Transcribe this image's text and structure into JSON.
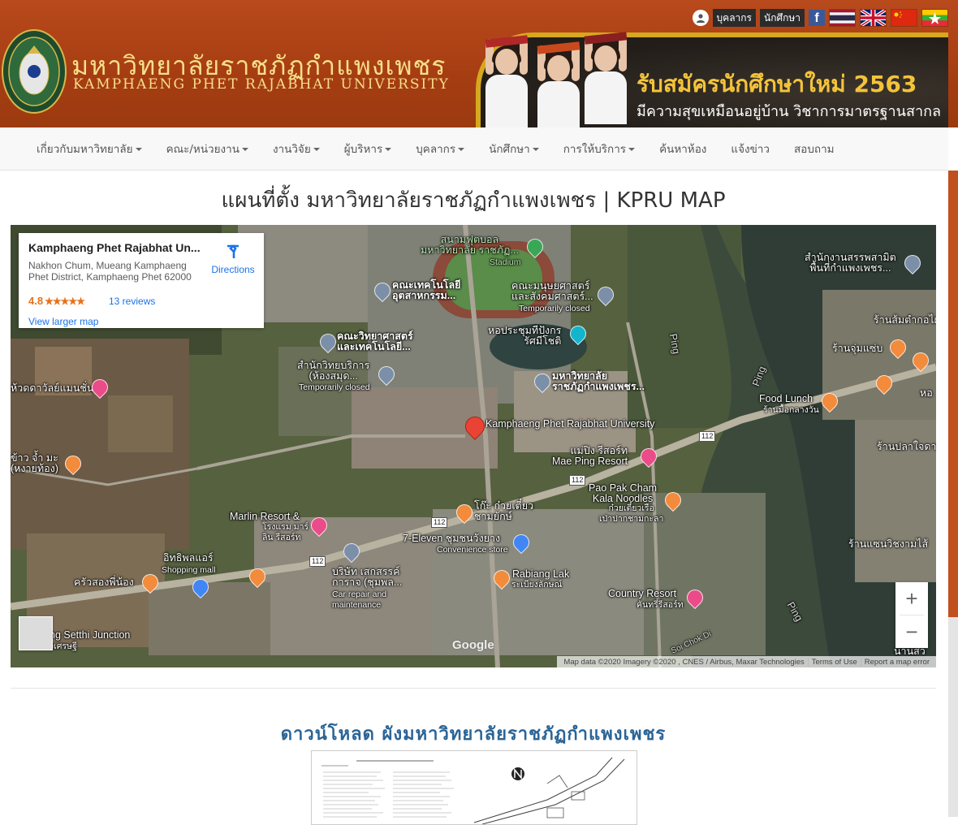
{
  "topbar": {
    "staff_label": "บุคลากร",
    "student_label": "นักศึกษา",
    "facebook_letter": "f"
  },
  "university": {
    "name_th": "มหาวิทยาลัยราชภัฏกำแพงเพชร",
    "name_en": "KAMPHAENG PHET RAJABHAT UNIVERSITY"
  },
  "banner": {
    "headline": "รับสมัครนักศึกษาใหม่ 2563",
    "subline": "มีความสุขเหมือนอยู่บ้าน วิชาการมาตรฐานสากล"
  },
  "nav": {
    "items": [
      {
        "label": "เกี่ยวกับมหาวิทยาลัย",
        "dropdown": true
      },
      {
        "label": "คณะ/หน่วยงาน",
        "dropdown": true
      },
      {
        "label": "งานวิจัย",
        "dropdown": true
      },
      {
        "label": "ผู้บริหาร",
        "dropdown": true
      },
      {
        "label": "บุคลากร",
        "dropdown": true
      },
      {
        "label": "นักศึกษา",
        "dropdown": true
      },
      {
        "label": "การให้บริการ",
        "dropdown": true
      },
      {
        "label": "ค้นหาห้อง",
        "dropdown": false
      },
      {
        "label": "แจ้งข่าว",
        "dropdown": false
      },
      {
        "label": "สอบถาม",
        "dropdown": false
      }
    ]
  },
  "page": {
    "title": "แผนที่ตั้ง มหาวิทยาลัยราชภัฏกำแพงเพชร | KPRU MAP",
    "download_title": "ดาวน์โหลด ผังมหาวิทยาลัยราชภัฏกำแพงเพชร"
  },
  "map": {
    "place_name": "Kamphaeng Phet Rajabhat Un...",
    "address": "Nakhon Chum, Mueang Kamphaeng Phet District, Kamphaeng Phet 62000",
    "rating": "4.8",
    "stars": "★★★★★",
    "reviews": "13 reviews",
    "directions": "Directions",
    "view_larger": "View larger map",
    "marker_label": "Kamphaeng Phet\nRajabhat University",
    "zoom_in": "+",
    "zoom_out": "−",
    "google": "Google",
    "footer": {
      "map_data": "Map data ©2020 Imagery ©2020 , CNES / Airbus, Maxar Technologies",
      "terms": "Terms of Use",
      "report": "Report a map error"
    },
    "routes": [
      "112",
      "112",
      "112",
      "112"
    ],
    "pois": {
      "stadium": "สนามฟุตบอล\nมหาวิทยาลัย ราชภัฏ...",
      "stadium_en": "Stadium",
      "tech": "คณะเทคโนโลยี\nอุตสาหกรรม...",
      "human": "คณะมนุษยศาสตร์\nและสังคมศาสตร์...",
      "human_status": "Temporarily closed",
      "hall": "หอประชุมทีปังกร\nรัศมีโชติ",
      "science": "คณะวิทยาศาสตร์\nและเทคโนโลยี...",
      "library": "สำนักวิทยบริการ\n(ห้องสมุด...",
      "library_status": "Temporarily closed",
      "kpru": "มหาวิทยาลัย\nราชภัฏกำแพงเพชร...",
      "office": "สำนักงานสรรพสามิต\nพื้นที่กำแพงเพชร...",
      "somtam": "ร้านส้มตำกอไผ่",
      "junjam": "ร้านจุ่มแซ่บ",
      "food_lunch": "Food Lunch",
      "food_lunch_th": "ร้านมื้อกลางวัน",
      "maeping": "แม่ปิง รีสอร์ท\nMae Ping Resort",
      "pao": "Pao Pak Cham\nKala Noodles",
      "pao_th": "ก๋วยเตี๋ยวเรือ\nเป่าปากชามกะลา",
      "pla": "ร้านปลาใจดาม",
      "khao": "ข้าว จ้ำ มะ\n(หงายท้อง)",
      "dara": "ห้วดดาวัลย์แมนชั่น",
      "marlin": "Marlin Resort &",
      "marlin_th": "โรงแรม มาร์\nลิน รีสอร์ท",
      "koh": "โก๊ะ ก๋วยเตี๋ยว\nชามยักษ์",
      "seven": "7-Eleven ชุมชนวังยาง",
      "seven_sub": "Convenience store",
      "itip": "อิทธิพลแอร์",
      "itip_sub": "Shopping mall",
      "krua": "ครัวสองพี่น้อง",
      "garage": "บริษัท เสกสรรค์\nการาจ (ชุมพล...",
      "garage_sub": "Car repair and\nmaintenance",
      "rabiang": "Rabiang Lak",
      "rabiang_th": "ระเบียงลักษณ์",
      "country": "Country Resort",
      "country_th": "คันทรี่รีสอร์ท",
      "saen": "ร้านแซนวิชงามไส้",
      "setthi": "ng Setthi Junction",
      "setthi_th": "ิงเศรษฐี",
      "ping": "Ping",
      "soi": "Soi Chok Di",
      "ho": "หอ",
      "nan": "นานสว"
    }
  },
  "colors": {
    "header_bg": "#a63d12",
    "title_gold": "#f6df8a",
    "banner_gold": "#f3c33a",
    "nav_bg": "#f8f8f8",
    "link_blue": "#2a6496"
  }
}
